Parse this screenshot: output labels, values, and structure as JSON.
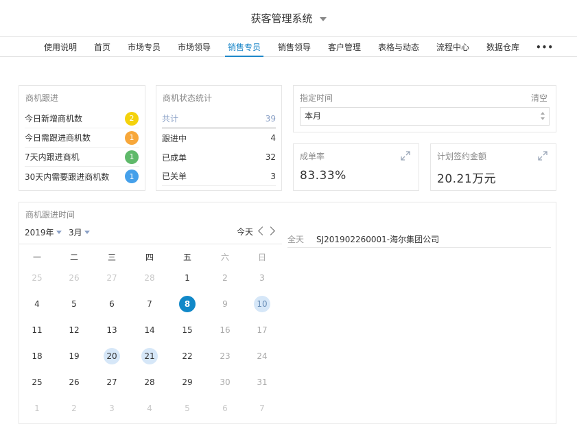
{
  "header": {
    "title": "获客管理系统"
  },
  "nav": {
    "items": [
      "使用说明",
      "首页",
      "市场专员",
      "市场领导",
      "销售专员",
      "销售领导",
      "客户管理",
      "表格与动态",
      "流程中心",
      "数据仓库"
    ],
    "more": "•••",
    "active_index": 4
  },
  "followup": {
    "title": "商机跟进",
    "rows": [
      {
        "label": "今日新增商机数",
        "count": "2",
        "color": "#f4d20c"
      },
      {
        "label": "今日需跟进商机数",
        "count": "1",
        "color": "#f7a73a"
      },
      {
        "label": "7天内跟进商机",
        "count": "1",
        "color": "#5fb96a"
      },
      {
        "label": "30天内需要跟进商机数",
        "count": "1",
        "color": "#45a0ea"
      }
    ]
  },
  "status": {
    "title": "商机状态统计",
    "total_label": "共计",
    "total_value": "39",
    "rows": [
      {
        "label": "跟进中",
        "value": "4"
      },
      {
        "label": "已成单",
        "value": "32"
      },
      {
        "label": "已关单",
        "value": "3"
      }
    ]
  },
  "time_filter": {
    "title": "指定时间",
    "clear": "清空",
    "selected": "本月"
  },
  "conversion": {
    "title": "成单率",
    "value": "83.33%"
  },
  "contract": {
    "title": "计划签约金额",
    "value": "20.21万元"
  },
  "calendar": {
    "title": "商机跟进时间",
    "year": "2019年",
    "month": "3月",
    "today_label": "今天",
    "weekdays": [
      "一",
      "二",
      "三",
      "四",
      "五",
      "六",
      "日"
    ],
    "weeks": [
      [
        {
          "d": "25",
          "m": 1
        },
        {
          "d": "26",
          "m": 1
        },
        {
          "d": "27",
          "m": 1
        },
        {
          "d": "28",
          "m": 1
        },
        {
          "d": "1"
        },
        {
          "d": "2"
        },
        {
          "d": "3"
        }
      ],
      [
        {
          "d": "4"
        },
        {
          "d": "5"
        },
        {
          "d": "6"
        },
        {
          "d": "7"
        },
        {
          "d": "8",
          "t": 1
        },
        {
          "d": "9"
        },
        {
          "d": "10",
          "e": 1
        }
      ],
      [
        {
          "d": "11"
        },
        {
          "d": "12"
        },
        {
          "d": "13"
        },
        {
          "d": "14"
        },
        {
          "d": "15"
        },
        {
          "d": "16"
        },
        {
          "d": "17"
        }
      ],
      [
        {
          "d": "18"
        },
        {
          "d": "19"
        },
        {
          "d": "20",
          "e": 1
        },
        {
          "d": "21",
          "e": 1
        },
        {
          "d": "22"
        },
        {
          "d": "23"
        },
        {
          "d": "24"
        }
      ],
      [
        {
          "d": "25"
        },
        {
          "d": "26"
        },
        {
          "d": "27"
        },
        {
          "d": "28"
        },
        {
          "d": "29"
        },
        {
          "d": "30"
        },
        {
          "d": "31"
        }
      ],
      [
        {
          "d": "1",
          "m": 1
        },
        {
          "d": "2",
          "m": 1
        },
        {
          "d": "3",
          "m": 1
        },
        {
          "d": "4",
          "m": 1
        },
        {
          "d": "5",
          "m": 1
        },
        {
          "d": "6",
          "m": 1
        },
        {
          "d": "7",
          "m": 1
        }
      ]
    ]
  },
  "events": [
    {
      "time": "全天",
      "name": "SJ201902260001-海尔集团公司"
    }
  ]
}
